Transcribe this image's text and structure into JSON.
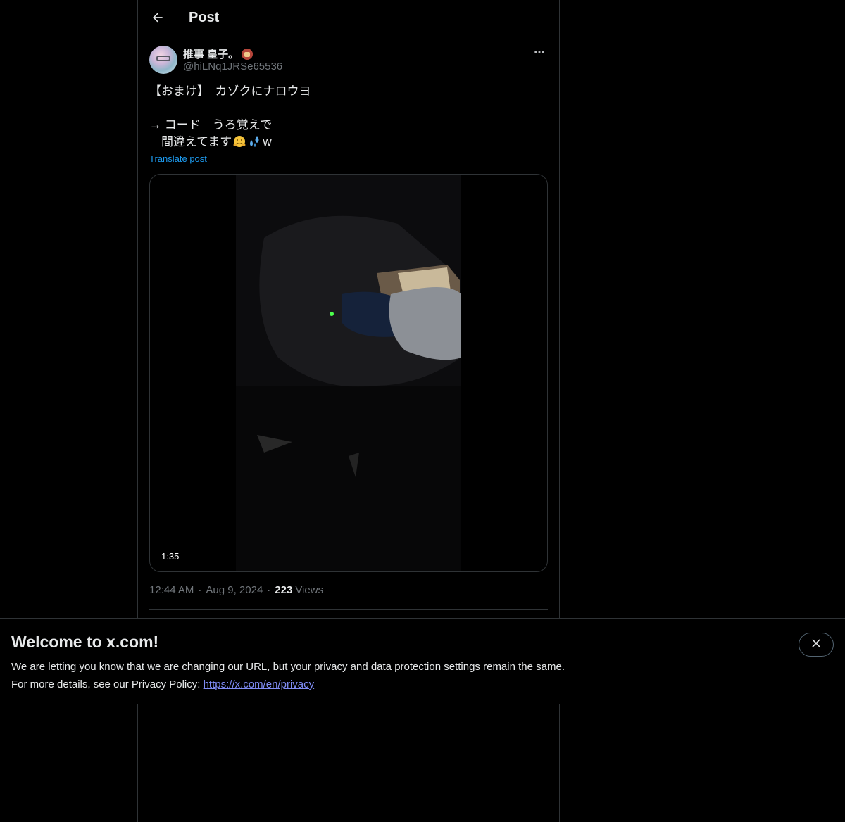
{
  "header": {
    "title": "Post",
    "back_icon": "arrow-left-icon"
  },
  "author": {
    "display_name": "推事 皇子。",
    "name_emoji": "badge-emoji-icon",
    "handle": "@hiLNq1JRSe65536",
    "more_icon": "more-horizontal-icon"
  },
  "post": {
    "line1": "【おまけ】　カゾクにナロウヨ",
    "line2": "→ コード　うろ覚えで",
    "line3_prefix": "　間違えてます",
    "line3_suffix": "w",
    "emoji_1": "hugging-face-emoji",
    "emoji_2": "sweat-droplets-emoji",
    "translate_label": "Translate post"
  },
  "media": {
    "type": "video",
    "duration": "1:35"
  },
  "meta": {
    "time": "12:44 AM",
    "date": "Aug 9, 2024",
    "views_count": "223",
    "views_label": "Views"
  },
  "banner": {
    "title": "Welcome to x.com!",
    "line1": "We are letting you know that we are changing our URL, but your privacy and data protection settings remain the same.",
    "line2_prefix": "For more details, see our Privacy Policy: ",
    "link": "https://x.com/en/privacy",
    "close_icon": "close-icon"
  },
  "colors": {
    "background": "#000000",
    "text": "#e7e9ea",
    "secondary_text": "#71767b",
    "link": "#1d9bf0",
    "border": "#2f3336"
  }
}
